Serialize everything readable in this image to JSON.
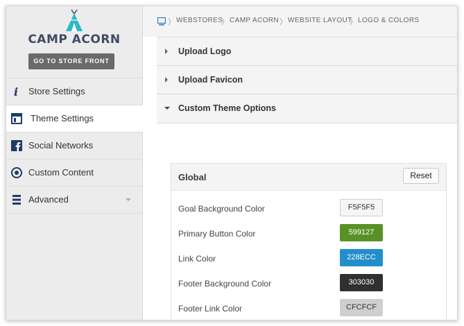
{
  "sidebar": {
    "brand": "CAMP ACORN",
    "store_front_label": "GO TO STORE FRONT",
    "items": [
      {
        "label": "Store Settings",
        "icon": "info-icon"
      },
      {
        "label": "Theme Settings",
        "icon": "layout-icon"
      },
      {
        "label": "Social Networks",
        "icon": "facebook-icon"
      },
      {
        "label": "Custom Content",
        "icon": "target-icon"
      },
      {
        "label": "Advanced",
        "icon": "menu-icon"
      }
    ],
    "active_item": "Theme Settings"
  },
  "breadcrumb": [
    "WEBSTORES",
    "CAMP ACORN",
    "WEBSITE LAYOUT",
    "LOGO & COLORS"
  ],
  "accordion": [
    {
      "label": "Upload Logo",
      "expanded": false
    },
    {
      "label": "Upload Favicon",
      "expanded": false
    },
    {
      "label": "Custom Theme Options",
      "expanded": true
    }
  ],
  "global": {
    "title": "Global",
    "reset_label": "Reset",
    "colors": [
      {
        "label": "Goal Background Color",
        "value": "F5F5F5",
        "hex": "#F5F5F5",
        "text": "#333333"
      },
      {
        "label": "Primary Button Color",
        "value": "599127",
        "hex": "#599127",
        "text": "#ffffff"
      },
      {
        "label": "Link Color",
        "value": "228ECC",
        "hex": "#228ECC",
        "text": "#ffffff"
      },
      {
        "label": "Footer Background Color",
        "value": "303030",
        "hex": "#303030",
        "text": "#ffffff"
      },
      {
        "label": "Footer Link Color",
        "value": "CFCFCF",
        "hex": "#CFCFCF",
        "text": "#333333"
      }
    ]
  },
  "colors": {
    "brand": "#3f4a64",
    "teepee": "#2fb7c6"
  }
}
